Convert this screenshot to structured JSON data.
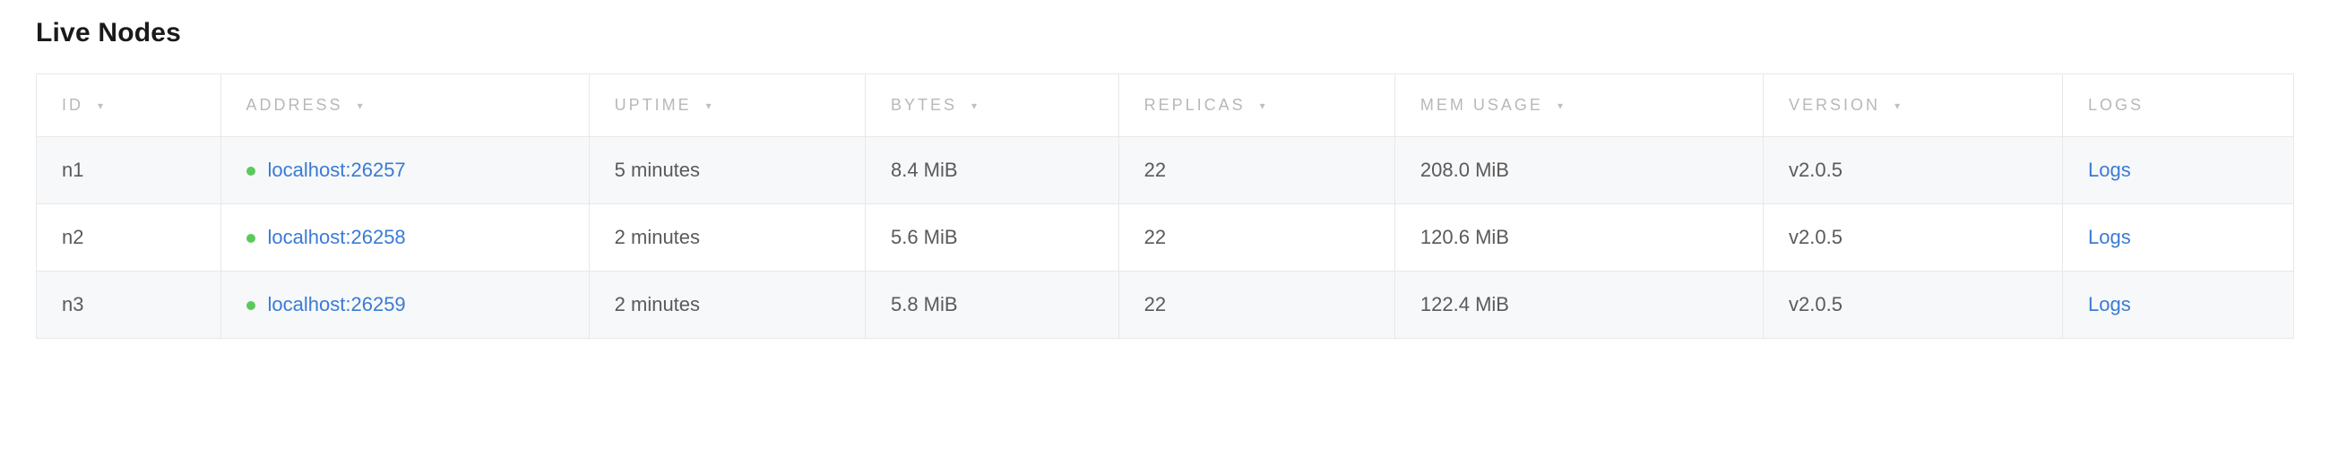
{
  "title": "Live Nodes",
  "status_color": "#5cc95c",
  "columns": {
    "id": "ID",
    "address": "ADDRESS",
    "uptime": "UPTIME",
    "bytes": "BYTES",
    "replicas": "REPLICAS",
    "mem": "MEM USAGE",
    "version": "VERSION",
    "logs": "LOGS"
  },
  "sort_indicator": "▾",
  "logs_label": "Logs",
  "nodes": [
    {
      "id": "n1",
      "address": "localhost:26257",
      "uptime": "5 minutes",
      "bytes": "8.4 MiB",
      "replicas": "22",
      "mem": "208.0 MiB",
      "version": "v2.0.5"
    },
    {
      "id": "n2",
      "address": "localhost:26258",
      "uptime": "2 minutes",
      "bytes": "5.6 MiB",
      "replicas": "22",
      "mem": "120.6 MiB",
      "version": "v2.0.5"
    },
    {
      "id": "n3",
      "address": "localhost:26259",
      "uptime": "2 minutes",
      "bytes": "5.8 MiB",
      "replicas": "22",
      "mem": "122.4 MiB",
      "version": "v2.0.5"
    }
  ]
}
